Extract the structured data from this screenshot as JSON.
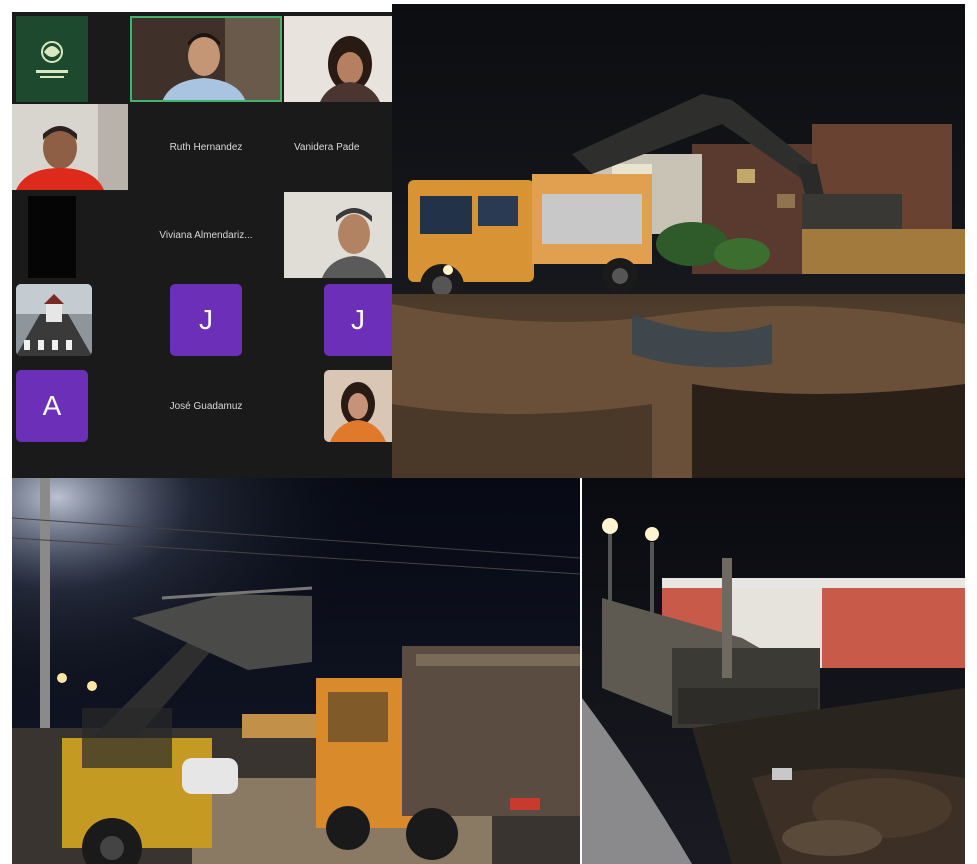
{
  "zoom": {
    "participants": {
      "ruth": "Ruth Hernandez",
      "vanidera": "Vanidera Pade",
      "viviana": "Viviana Almendariz...",
      "jose": "José Guadamuz"
    },
    "avatar_letters": {
      "j1": "J",
      "j2": "J",
      "a": "A"
    },
    "colors": {
      "speaker_border": "#3fb46b",
      "avatar_bg": "#6b2fb8",
      "grid_bg": "#1a1a1a",
      "logo_bg": "#1d4a2f"
    }
  },
  "photos": [
    {
      "subject": "excavator loading dump truck at night"
    },
    {
      "subject": "front loader and dump truck at night"
    },
    {
      "subject": "bulldozer pushing soil at night"
    }
  ]
}
